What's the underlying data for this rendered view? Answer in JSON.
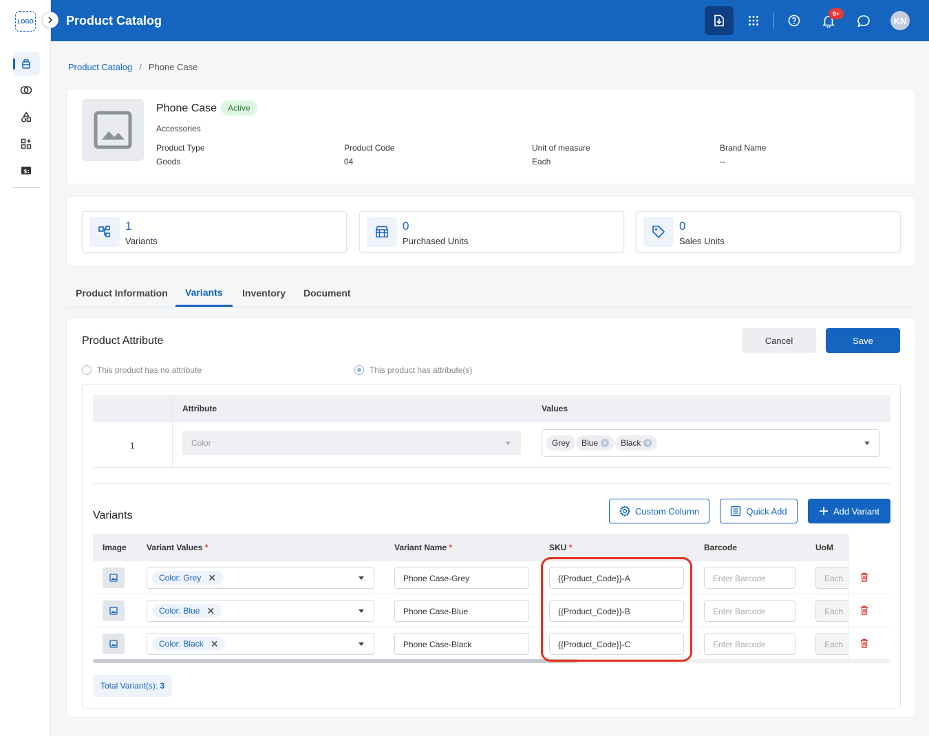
{
  "sidebar": {
    "logo": "LOGO",
    "items": [
      {
        "name": "catalog",
        "icon": "box-icon",
        "active": true
      },
      {
        "name": "link",
        "icon": "rings-icon"
      },
      {
        "name": "shapes",
        "icon": "shapes-icon"
      },
      {
        "name": "apps",
        "icon": "apps-add-icon"
      },
      {
        "name": "billing",
        "icon": "dollar-card-icon"
      }
    ]
  },
  "header": {
    "title": "Product Catalog",
    "notification_badge": "9+",
    "avatar_initials": "KN",
    "accent": "#1565c0"
  },
  "breadcrumb": {
    "root": "Product Catalog",
    "separator": "/",
    "current": "Phone Case"
  },
  "product": {
    "name": "Phone Case",
    "status": "Active",
    "category": "Accessories",
    "meta": [
      {
        "label": "Product Type",
        "value": "Goods"
      },
      {
        "label": "Product Code",
        "value": "04"
      },
      {
        "label": "Unit of measure",
        "value": "Each"
      },
      {
        "label": "Brand Name",
        "value": "--"
      }
    ]
  },
  "stats": [
    {
      "value": "1",
      "label": "Variants",
      "icon": "variants-tree-icon"
    },
    {
      "value": "0",
      "label": "Purchased Units",
      "icon": "store-icon"
    },
    {
      "value": "0",
      "label": "Sales Units",
      "icon": "tag-icon"
    }
  ],
  "tabs": [
    "Product Information",
    "Variants",
    "Inventory",
    "Document"
  ],
  "attribute_section": {
    "title": "Product Attribute",
    "cancel": "Cancel",
    "save": "Save",
    "radio_no": "This product has no attribute",
    "radio_yes": "This product has attribute(s)",
    "col_attribute": "Attribute",
    "col_values": "Values",
    "row_index": "1",
    "attribute_value": "Color",
    "chips": [
      "Grey",
      "Blue",
      "Black"
    ]
  },
  "variants_section": {
    "title": "Variants",
    "custom_column": "Custom Column",
    "quick_add": "Quick Add",
    "add_variant": "Add Variant",
    "columns": {
      "image": "Image",
      "values": "Variant Values",
      "name": "Variant Name",
      "sku": "SKU",
      "barcode": "Barcode",
      "uom": "UoM"
    },
    "required_mark": "*",
    "rows": [
      {
        "value": "Color: Grey",
        "name": "Phone Case-Grey",
        "sku": "{{Product_Code}}-A",
        "barcode_placeholder": "Enter Barcode",
        "uom": "Each"
      },
      {
        "value": "Color: Blue",
        "name": "Phone Case-Blue",
        "sku": "{{Product_Code}}-B",
        "barcode_placeholder": "Enter Barcode",
        "uom": "Each"
      },
      {
        "value": "Color: Black",
        "name": "Phone Case-Black",
        "sku": "{{Product_Code}}-C",
        "barcode_placeholder": "Enter Barcode",
        "uom": "Each"
      }
    ],
    "total_label": "Total Variant(s):",
    "total_value": "3"
  }
}
